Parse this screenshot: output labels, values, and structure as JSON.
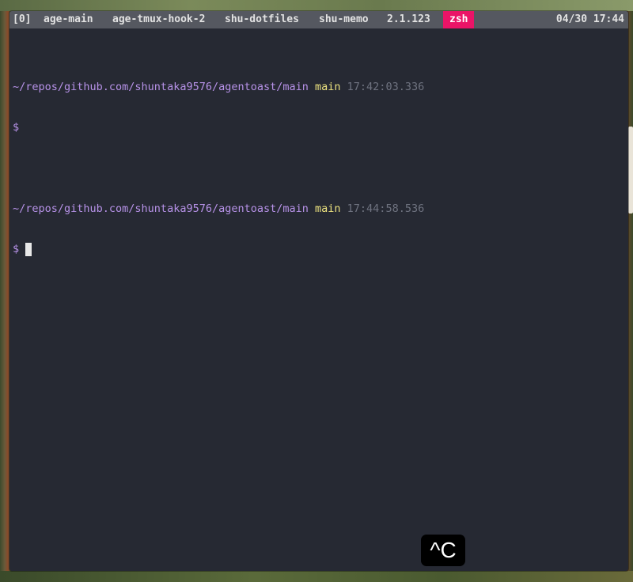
{
  "statusbar": {
    "session": "[0]",
    "windows": [
      {
        "label": "age-main",
        "active": false
      },
      {
        "label": "age-tmux-hook-2",
        "active": false
      },
      {
        "label": "shu-dotfiles",
        "active": false
      },
      {
        "label": "shu-memo",
        "active": false
      },
      {
        "label": "2.1.123",
        "active": false
      },
      {
        "label": "zsh",
        "active": true
      }
    ],
    "clock": "04/30 17:44",
    "active_color": "#ea1467"
  },
  "terminal": {
    "prompts": [
      {
        "path": "~/repos/github.com/shuntaka9576/agentoast/main",
        "branch": "main",
        "time": "17:42:03.336",
        "symbol": "$"
      },
      {
        "path": "~/repos/github.com/shuntaka9576/agentoast/main",
        "branch": "main",
        "time": "17:44:58.536",
        "symbol": "$"
      }
    ],
    "colors": {
      "path": "#b792e8",
      "branch": "#ece27f",
      "time": "#6f7380",
      "background": "#262933"
    }
  },
  "key_overlay": {
    "text": "^C"
  }
}
